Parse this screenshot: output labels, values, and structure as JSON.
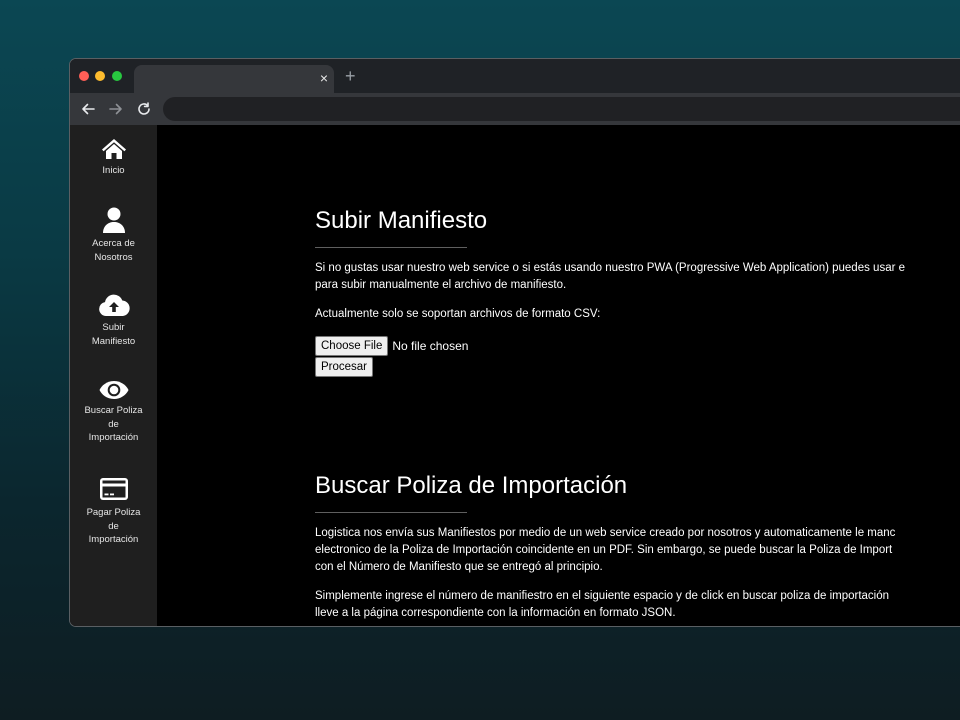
{
  "browser": {
    "tab_close": "×",
    "new_tab": "+",
    "icons": [
      "back-arrow-icon",
      "forward-arrow-icon",
      "reload-icon"
    ]
  },
  "sidebar": {
    "items": [
      {
        "label": "Inicio",
        "icon": "home-icon"
      },
      {
        "label": "Acerca de Nosotros",
        "icon": "user-icon"
      },
      {
        "label": "Subir Manifiesto",
        "icon": "cloud-upload-icon"
      },
      {
        "label": "Buscar Poliza de Importación",
        "icon": "eye-icon"
      },
      {
        "label": "Pagar Poliza de Importación",
        "icon": "credit-card-icon"
      }
    ]
  },
  "upload": {
    "title": "Subir Manifiesto",
    "paragraph1_line1": "Si no gustas usar nuestro web service o si estás usando nuestro PWA (Progressive Web Application) puedes usar e",
    "paragraph1_line2": "para subir manualmente el archivo de manifiesto.",
    "paragraph2": "Actualmente solo se soportan archivos de formato CSV:",
    "choose_file": "Choose File",
    "file_status": "No file chosen",
    "process_button": "Procesar"
  },
  "search": {
    "title": "Buscar Poliza de Importación",
    "paragraph1_line1": "Logistica nos envía sus Manifiestos por medio de un web service creado por nosotros y automaticamente le manc",
    "paragraph1_line2": "electronico de la Poliza de Importación coincidente en un PDF. Sin embargo, se puede buscar la Poliza de Import",
    "paragraph1_line3": "con el Número de Manifiesto que se entregó al principio.",
    "paragraph2_line1": "Simplemente ingrese el número de manifiestro en el siguiente espacio y de click en buscar poliza de importación",
    "paragraph2_line2": "lleve a la página correspondiente con la información en formato JSON."
  },
  "colors": {
    "background_top": "#0b4753",
    "content_bg": "#000000",
    "sidebar_bg": "#1f1f1f",
    "chrome_bg": "#35373b"
  }
}
